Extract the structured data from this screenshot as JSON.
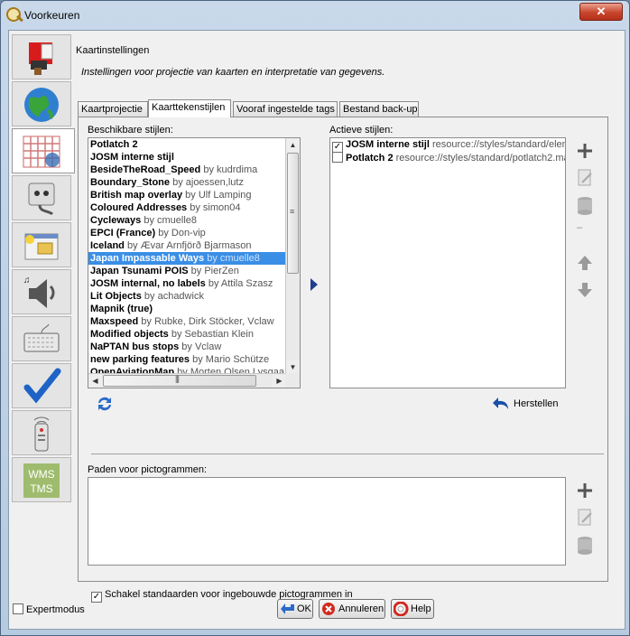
{
  "window": {
    "title": "Voorkeuren",
    "close_glyph": "✕"
  },
  "sidebar": {
    "items": [
      {
        "name": "paint-brush-icon"
      },
      {
        "name": "globe-icon"
      },
      {
        "name": "map-grid-icon",
        "selected": true
      },
      {
        "name": "plug-icon"
      },
      {
        "name": "menu-folder-icon"
      },
      {
        "name": "speaker-icon"
      },
      {
        "name": "keyboard-icon"
      },
      {
        "name": "checkmark-icon"
      },
      {
        "name": "remote-icon"
      },
      {
        "name": "wms-tms-icon",
        "label1": "WMS",
        "label2": "TMS"
      }
    ]
  },
  "header": {
    "title": "Kaartinstellingen",
    "description": "Instellingen voor projectie van kaarten en interpretatie van gegevens."
  },
  "tabs": [
    "Kaartprojectie",
    "Kaarttekenstijlen",
    "Vooraf ingestelde tags",
    "Bestand back-up"
  ],
  "available": {
    "label": "Beschikbare stijlen:",
    "items": [
      {
        "name": "Potlatch 2",
        "by": ""
      },
      {
        "name": "JOSM interne stijl",
        "by": ""
      },
      {
        "name": "BesideTheRoad_Speed",
        "by": "by kudrdima"
      },
      {
        "name": "Boundary_Stone",
        "by": "by ajoessen,lutz"
      },
      {
        "name": "British map overlay",
        "by": "by Ulf Lamping"
      },
      {
        "name": "Coloured Addresses",
        "by": "by simon04"
      },
      {
        "name": "Cycleways",
        "by": "by cmuelle8"
      },
      {
        "name": "EPCI (France)",
        "by": "by Don-vip"
      },
      {
        "name": "Iceland",
        "by": "by Ævar Arnfjörð Bjarmason"
      },
      {
        "name": "Japan Impassable Ways",
        "by": "by cmuelle8",
        "selected": true
      },
      {
        "name": "Japan Tsunami POIS",
        "by": "by PierZen"
      },
      {
        "name": "JOSM internal, no labels",
        "by": "by Attila Szasz"
      },
      {
        "name": "Lit Objects",
        "by": "by achadwick"
      },
      {
        "name": "Mapnik (true)",
        "by": ""
      },
      {
        "name": "Maxspeed",
        "by": "by Rubke, Dirk Stöcker, Vclaw"
      },
      {
        "name": "Modified objects",
        "by": "by Sebastian Klein"
      },
      {
        "name": "NaPTAN bus stops",
        "by": "by Vclaw"
      },
      {
        "name": "new parking features",
        "by": "by Mario Schütze"
      },
      {
        "name": "OpenAviationMap",
        "by": "by Morten Olsen Lysgaa"
      }
    ]
  },
  "active": {
    "label": "Actieve stijlen:",
    "items": [
      {
        "name": "JOSM interne stijl",
        "src": "resource://styles/standard/elemstyles.mapcss",
        "checked": true
      },
      {
        "name": "Potlatch 2",
        "src": "resource://styles/standard/potlatch2.mapcss",
        "checked": false
      }
    ]
  },
  "restore_label": "Herstellen",
  "icon_paths_label": "Paden voor pictogrammen:",
  "default_icons_checkbox": {
    "label": "Schakel standaarden voor ingebouwde pictogrammen in",
    "checked": true
  },
  "footer": {
    "expert_label": "Expertmodus",
    "ok": "OK",
    "cancel": "Annuleren",
    "help": "Help"
  },
  "icons": {
    "dash": "–"
  }
}
